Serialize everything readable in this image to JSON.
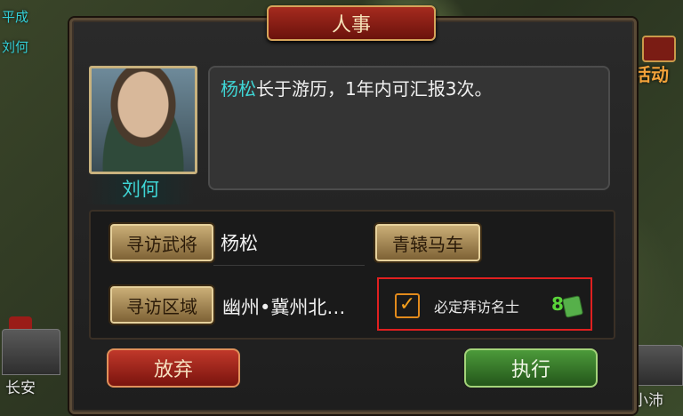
{
  "map": {
    "labels": {
      "top_left_1": "平成",
      "top_left_2": "刘何",
      "activity": "活动",
      "city_left": "长安",
      "city_right": "小沛"
    }
  },
  "dialog": {
    "title": "人事",
    "officer_name": "刘何",
    "message_highlight": "杨松",
    "message_text": "长于游历，1年内可汇报3次。",
    "visit_general_label": "寻访武将",
    "visit_general_value": "杨松",
    "carriage_label": "青辕马车",
    "visit_region_label": "寻访区域",
    "visit_region_value": "幽州•冀州北…",
    "guarantee_label": "必定拜访名士",
    "guarantee_checked": true,
    "guarantee_cost": "8",
    "cancel_label": "放弃",
    "execute_label": "执行"
  },
  "colors": {
    "highlight_cyan": "#3fd6d6",
    "cost_green": "#5ad43a",
    "selection_border": "#e02020"
  },
  "icons": [
    "activity-icon",
    "checkmark-icon",
    "coin-icon"
  ]
}
